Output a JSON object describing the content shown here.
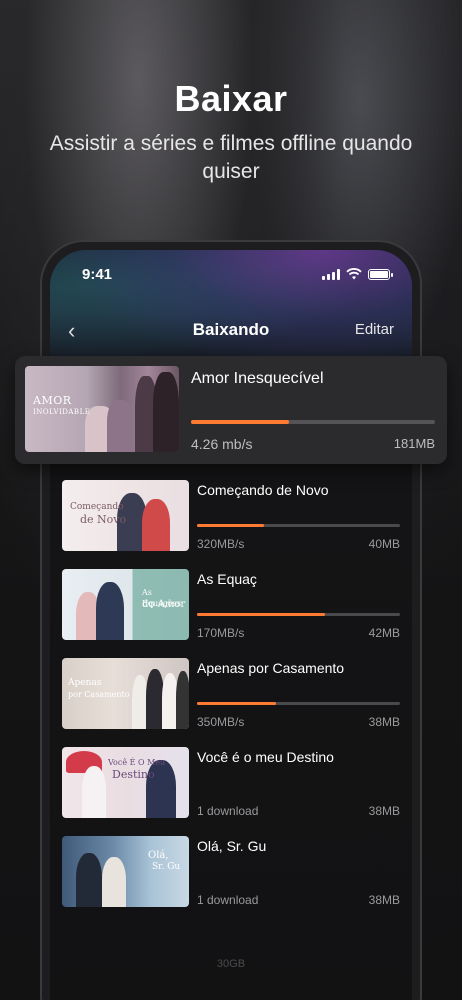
{
  "hero": {
    "title": "Baixar",
    "subtitle": "Assistir a séries e filmes offline quando quiser"
  },
  "status_bar": {
    "time": "9:41"
  },
  "nav": {
    "back_icon": "chevron-left-icon",
    "title": "Baixando",
    "edit_label": "Editar"
  },
  "featured": {
    "title": "Amor Inesquecível",
    "thumb_title_line1": "AMOR",
    "thumb_title_line2": "INOLVIDABLE",
    "progress": 0.4,
    "speed": "4.26 mb/s",
    "size": "181MB"
  },
  "downloads": [
    {
      "title": "Começando de Novo",
      "thumb_text_1": "Começando",
      "thumb_text_2": "de Novo",
      "progress": 0.33,
      "left": "320MB/s",
      "right": "40MB"
    },
    {
      "title": "As Equaç",
      "thumb_text_1": "As Equações",
      "thumb_text_2": "do Amor",
      "progress": 0.63,
      "left": "170MB/s",
      "right": "42MB"
    },
    {
      "title": "Apenas por Casamento",
      "thumb_text_1": "Apenas",
      "thumb_text_2": "por Casamento",
      "progress": 0.39,
      "left": "350MB/s",
      "right": "38MB"
    },
    {
      "title": "Você é o meu Destino",
      "thumb_text_1": "Você É O Meu",
      "thumb_text_2": "Destino",
      "progress": null,
      "left": "1 download",
      "right": "38MB"
    },
    {
      "title": "Olá, Sr. Gu",
      "thumb_text_1": "Olá,",
      "thumb_text_2": "Sr. Gu",
      "progress": null,
      "left": "1 download",
      "right": "38MB"
    }
  ],
  "storage_label": "30GB",
  "colors": {
    "accent": "#ff7a33",
    "background": "#121213",
    "featured_card": "#2b2b2d"
  }
}
